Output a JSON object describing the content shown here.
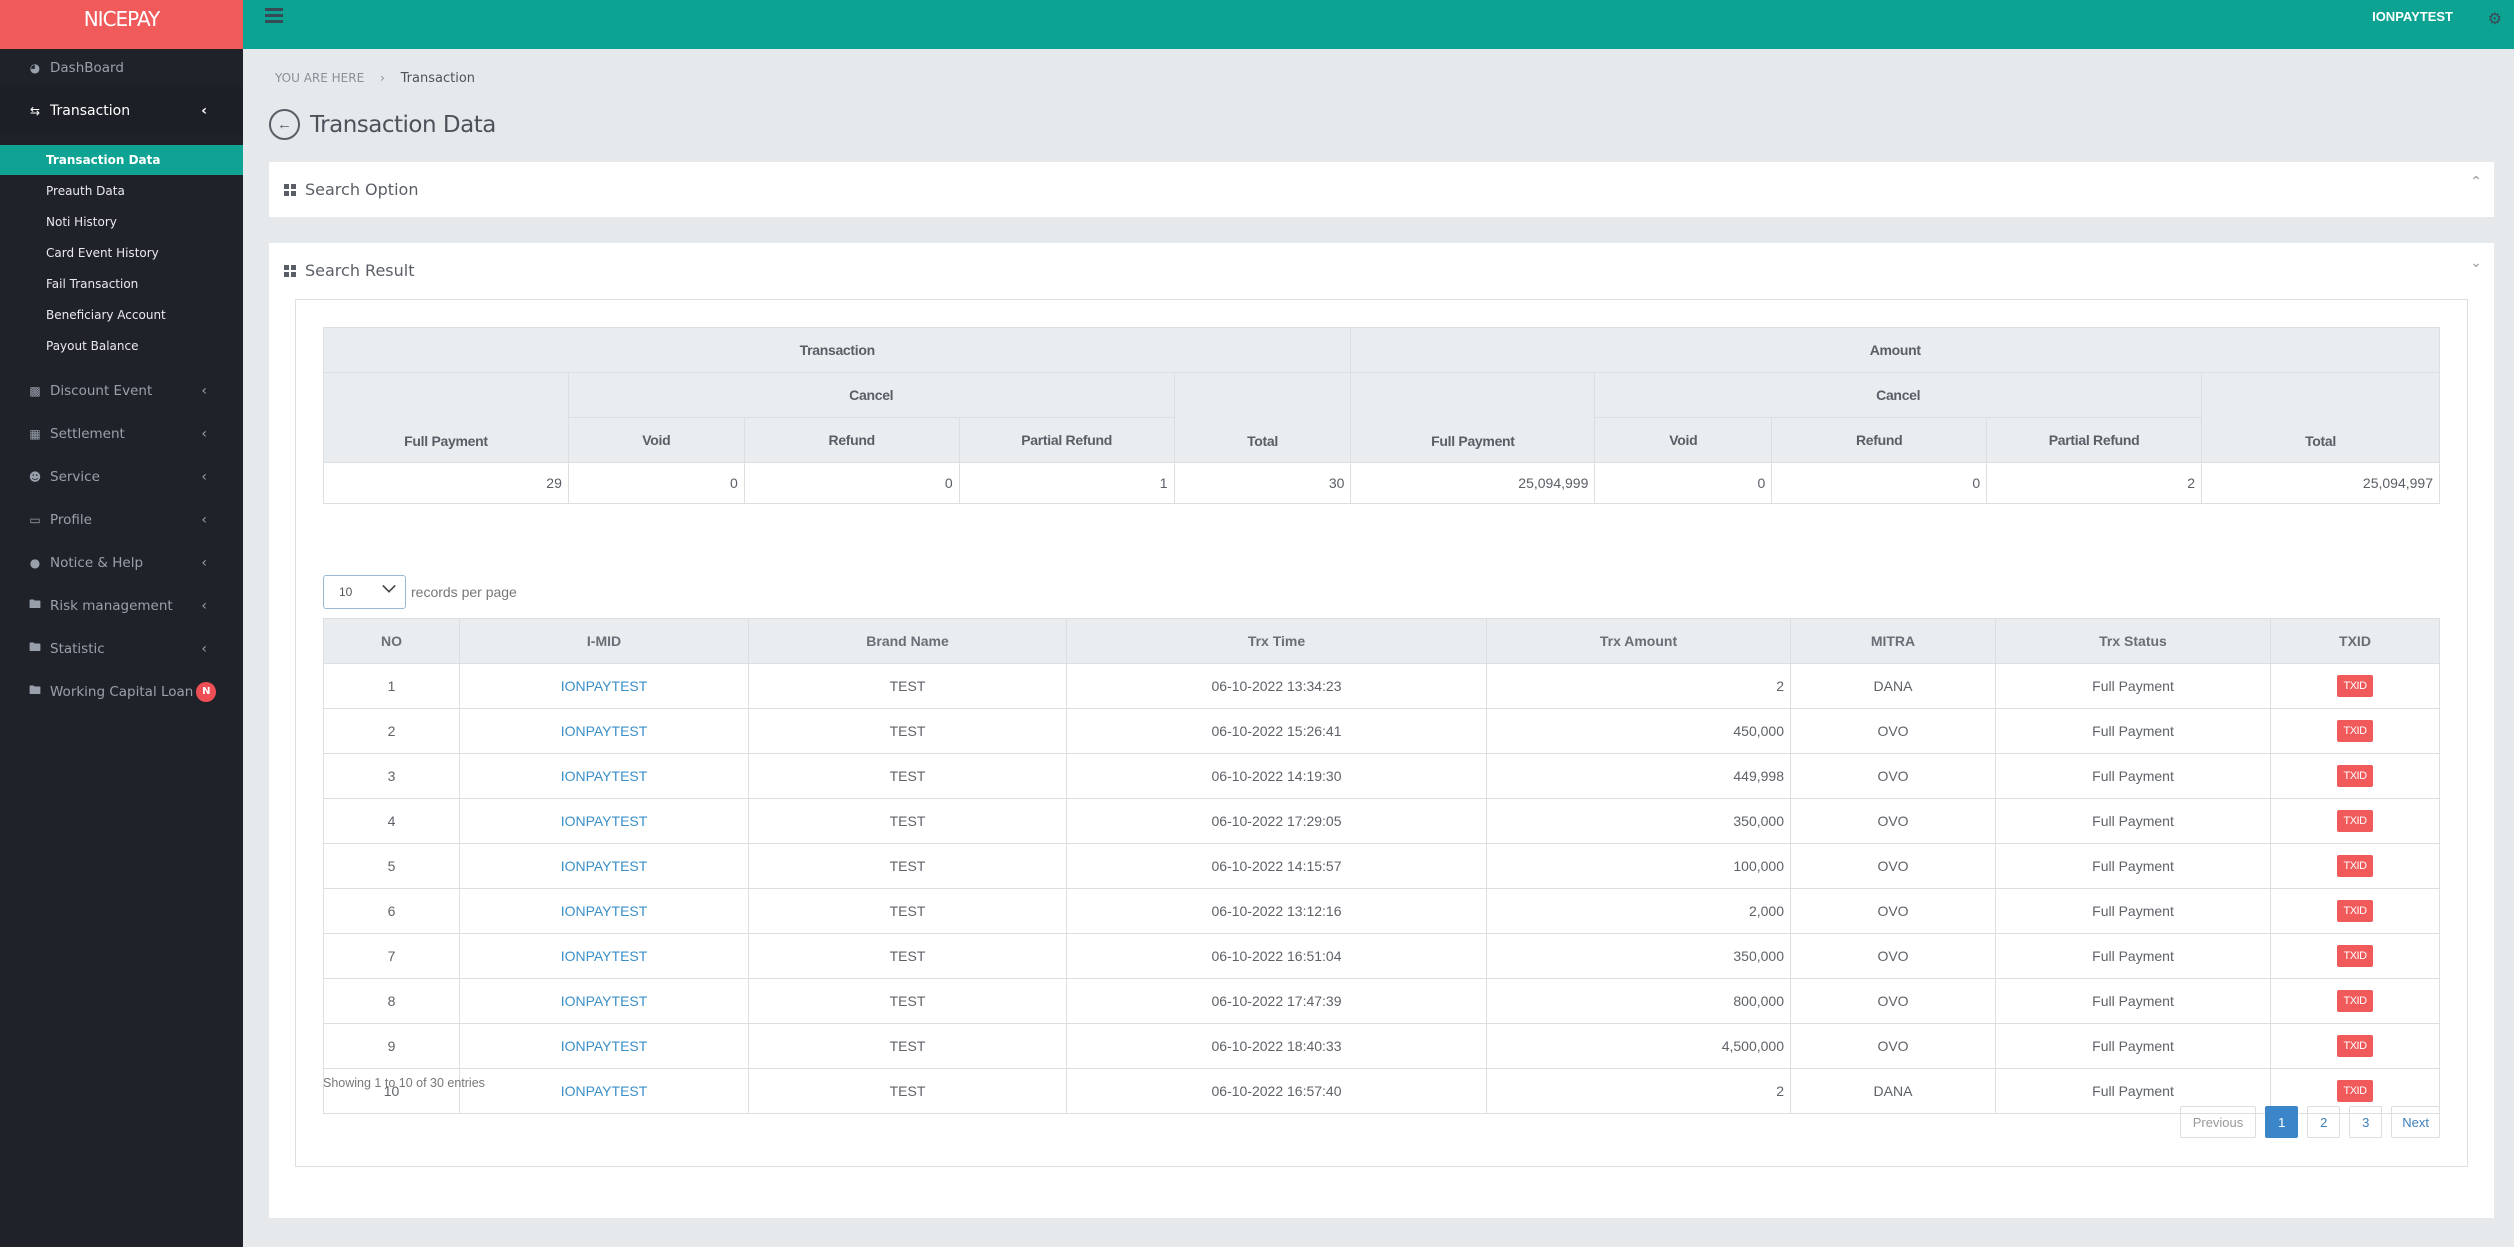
{
  "brand": "NICEPAY",
  "topbar": {
    "user": "IONPAYTEST"
  },
  "sidebar": {
    "items": [
      {
        "label": "DashBoard",
        "icon": "dashboard-icon"
      },
      {
        "label": "Transaction",
        "icon": "exchange-icon",
        "expanded": true,
        "children": [
          {
            "label": "Transaction Data",
            "active": true
          },
          {
            "label": "Preauth Data"
          },
          {
            "label": "Noti History"
          },
          {
            "label": "Card Event History"
          },
          {
            "label": "Fail Transaction"
          },
          {
            "label": "Beneficiary Account"
          },
          {
            "label": "Payout Balance"
          }
        ]
      },
      {
        "label": "Discount Event",
        "icon": "bar-chart-icon"
      },
      {
        "label": "Settlement",
        "icon": "calendar-icon"
      },
      {
        "label": "Service",
        "icon": "users-icon"
      },
      {
        "label": "Profile",
        "icon": "monitor-icon"
      },
      {
        "label": "Notice & Help",
        "icon": "comment-icon"
      },
      {
        "label": "Risk management",
        "icon": "folder-icon"
      },
      {
        "label": "Statistic",
        "icon": "folder-icon"
      },
      {
        "label": "Working Capital Loan",
        "icon": "folder-icon",
        "badge": "N"
      }
    ]
  },
  "breadcrumb": {
    "root": "YOU ARE HERE",
    "current": "Transaction"
  },
  "page": {
    "title": "Transaction Data"
  },
  "panels": {
    "search_option": "Search Option",
    "search_result": "Search Result"
  },
  "summary": {
    "groups": {
      "transaction": "Transaction",
      "amount": "Amount",
      "cancel": "Cancel"
    },
    "cols": {
      "full_payment": "Full Payment",
      "void": "Void",
      "refund": "Refund",
      "partial_refund": "Partial Refund",
      "total": "Total"
    },
    "transaction": {
      "full_payment": "29",
      "void": "0",
      "refund": "0",
      "partial_refund": "1",
      "total": "30"
    },
    "amount": {
      "full_payment": "25,094,999",
      "void": "0",
      "refund": "0",
      "partial_refund": "2",
      "total": "25,094,997"
    }
  },
  "length": {
    "value": "10",
    "label": "records per page"
  },
  "table": {
    "headers": [
      "NO",
      "I-MID",
      "Brand Name",
      "Trx Time",
      "Trx Amount",
      "MITRA",
      "Trx Status",
      "TXID"
    ],
    "txid_label": "TXID",
    "rows": [
      {
        "no": "1",
        "imid": "IONPAYTEST",
        "brand": "TEST",
        "time": "06-10-2022 13:34:23",
        "amount": "2",
        "mitra": "DANA",
        "status": "Full Payment"
      },
      {
        "no": "2",
        "imid": "IONPAYTEST",
        "brand": "TEST",
        "time": "06-10-2022 15:26:41",
        "amount": "450,000",
        "mitra": "OVO",
        "status": "Full Payment"
      },
      {
        "no": "3",
        "imid": "IONPAYTEST",
        "brand": "TEST",
        "time": "06-10-2022 14:19:30",
        "amount": "449,998",
        "mitra": "OVO",
        "status": "Full Payment"
      },
      {
        "no": "4",
        "imid": "IONPAYTEST",
        "brand": "TEST",
        "time": "06-10-2022 17:29:05",
        "amount": "350,000",
        "mitra": "OVO",
        "status": "Full Payment"
      },
      {
        "no": "5",
        "imid": "IONPAYTEST",
        "brand": "TEST",
        "time": "06-10-2022 14:15:57",
        "amount": "100,000",
        "mitra": "OVO",
        "status": "Full Payment"
      },
      {
        "no": "6",
        "imid": "IONPAYTEST",
        "brand": "TEST",
        "time": "06-10-2022 13:12:16",
        "amount": "2,000",
        "mitra": "OVO",
        "status": "Full Payment"
      },
      {
        "no": "7",
        "imid": "IONPAYTEST",
        "brand": "TEST",
        "time": "06-10-2022 16:51:04",
        "amount": "350,000",
        "mitra": "OVO",
        "status": "Full Payment"
      },
      {
        "no": "8",
        "imid": "IONPAYTEST",
        "brand": "TEST",
        "time": "06-10-2022 17:47:39",
        "amount": "800,000",
        "mitra": "OVO",
        "status": "Full Payment"
      },
      {
        "no": "9",
        "imid": "IONPAYTEST",
        "brand": "TEST",
        "time": "06-10-2022 18:40:33",
        "amount": "4,500,000",
        "mitra": "OVO",
        "status": "Full Payment"
      },
      {
        "no": "10",
        "imid": "IONPAYTEST",
        "brand": "TEST",
        "time": "06-10-2022 16:57:40",
        "amount": "2",
        "mitra": "DANA",
        "status": "Full Payment"
      }
    ]
  },
  "info": "Showing 1 to 10 of 30 entries",
  "pagination": {
    "previous": "Previous",
    "pages": [
      "1",
      "2",
      "3"
    ],
    "current": "1",
    "next": "Next"
  }
}
